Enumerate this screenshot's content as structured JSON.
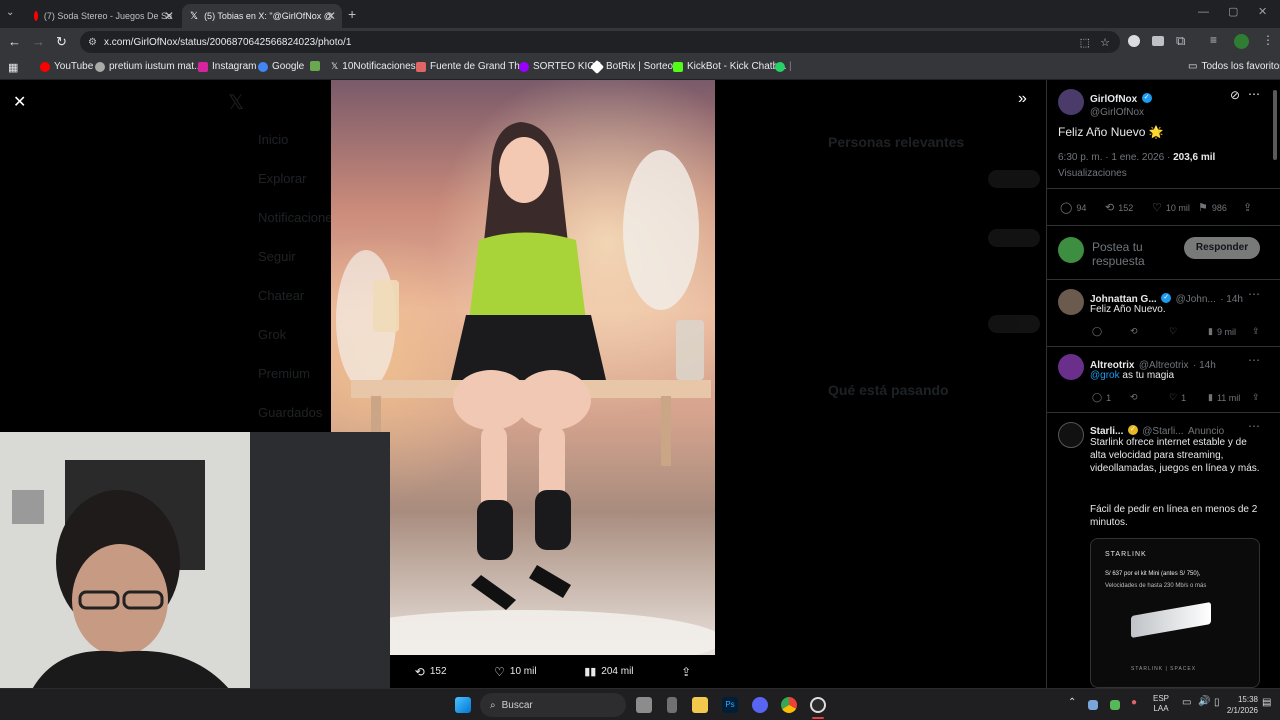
{
  "tabs": [
    {
      "title": "(7) Soda Stereo - Juegos De Se",
      "icon_color": "#ff0000"
    },
    {
      "title": "(5) Tobias en X: \"@GirlOfNox @",
      "icon_color": "#ffffff"
    }
  ],
  "url": "x.com/GirlOfNox/status/2006870642566824023/photo/1",
  "bookmarks": [
    {
      "label": "YouTube",
      "color": "#ff0000"
    },
    {
      "label": "pretium iustum mat...",
      "color": "#aaaaaa"
    },
    {
      "label": "Instagram",
      "color": "#d6249f"
    },
    {
      "label": "Google",
      "color": "#4285f4"
    },
    {
      "label": "",
      "color": "#6aa84f"
    },
    {
      "label": "10Notificaciones",
      "color": "#ffffff"
    },
    {
      "label": "Fuente de Grand Th...",
      "color": "#e06666"
    },
    {
      "label": "SORTEO KICK",
      "color": "#9900ff"
    },
    {
      "label": "BotRix | Sorteos",
      "color": "#ffffff"
    },
    {
      "label": "KickBot - Kick Chatb...",
      "color": "#53fc18"
    },
    {
      "label": "",
      "color": "#25d366"
    }
  ],
  "bookmarks_all": "Todos los favoritos",
  "photo_actions": {
    "retweets": "152",
    "likes": "10 mil",
    "views": "204 mil"
  },
  "background_nav": [
    "Inicio",
    "Explorar",
    "Notificaciones",
    "Seguir",
    "Chatear",
    "Grok",
    "Premium",
    "Guardados"
  ],
  "background_side": {
    "relevant": "Personas relevantes",
    "trending": "Qué está pasando"
  },
  "tweet": {
    "name": "GirlOfNox",
    "handle": "@GirlOfNox",
    "text": "Feliz Año Nuevo 🌟",
    "time": "6:30 p. m. · 1 ene. 2026 · ",
    "views_count": "203,6 mil",
    "views_label": "Visualizaciones",
    "replies": "94",
    "retweets": "152",
    "likes": "10 mil",
    "bookmarks": "986"
  },
  "reply_box": {
    "placeholder": "Postea tu respuesta",
    "button": "Responder"
  },
  "replies": [
    {
      "name": "Johnattan G...",
      "handle": "@John...",
      "time": "· 14h",
      "text": "Feliz Año Nuevo.",
      "replies": "",
      "retweets": "",
      "likes": "",
      "views": "9 mil"
    },
    {
      "name": "Altreotrix",
      "handle": "@Altreotrix",
      "time": "· 14h",
      "mention": "@grok",
      "text": " as tu magia",
      "replies": "1",
      "retweets": "",
      "likes": "1",
      "views": "11 mil"
    }
  ],
  "ad": {
    "name": "Starli...",
    "handle": "@Starli...",
    "label": "Anuncio",
    "text1": "Starlink ofrece internet estable y de alta velocidad para streaming, videollamadas, juegos en línea y más.",
    "text2": "Fácil de pedir en línea en menos de 2 minutos.",
    "card_brand": "STARLINK",
    "card_price": "S/ 637 por el kit Mini (antes S/ 750),",
    "card_speed": "Velocidades de hasta 230 Mb/s o más",
    "card_foot": "STARLINK | SPACEX"
  },
  "taskbar": {
    "search": "Buscar",
    "lang1": "ESP",
    "lang2": "LAA",
    "time": "15:38",
    "date": "2/1/2026"
  }
}
